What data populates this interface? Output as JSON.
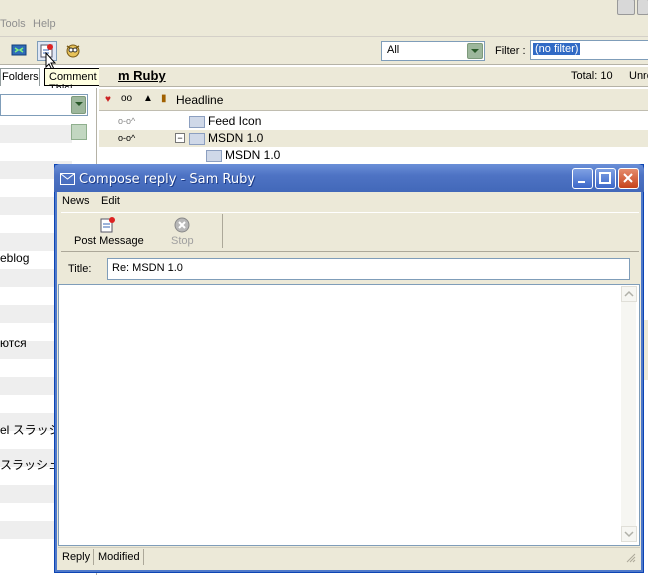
{
  "background_app": {
    "menu": [
      "Tools",
      "Help"
    ],
    "filter_select_value": "All",
    "filter_label": "Filter :",
    "filter_input_value": "(no filter)",
    "folders_tab": "Folders",
    "tooltip": "Comment This!",
    "feed_title": "m Ruby",
    "feed_total": "Total: 10",
    "feed_unread": "Unre",
    "headline_column": "Headline",
    "left_items": [
      "eblog",
      "ются",
      "el スラッシュ",
      "スラッシュ"
    ],
    "rows": [
      {
        "title": "Feed Icon"
      },
      {
        "title": "MSDN 1.0"
      },
      {
        "title": "MSDN 1.0"
      }
    ]
  },
  "compose": {
    "window_title": "Compose reply - Sam Ruby",
    "menu": [
      "News",
      "Edit"
    ],
    "toolbar": {
      "post_label": "Post Message",
      "stop_label": "Stop"
    },
    "title_label": "Title:",
    "title_value": "Re: MSDN 1.0",
    "body_text": "",
    "status": {
      "reply": "Reply",
      "modified": "Modified"
    }
  },
  "colors": {
    "titlebar": "#4e73c4",
    "close_button": "#c6421c",
    "selection": "#316ac5",
    "tooltip_bg": "#ffffe1"
  }
}
